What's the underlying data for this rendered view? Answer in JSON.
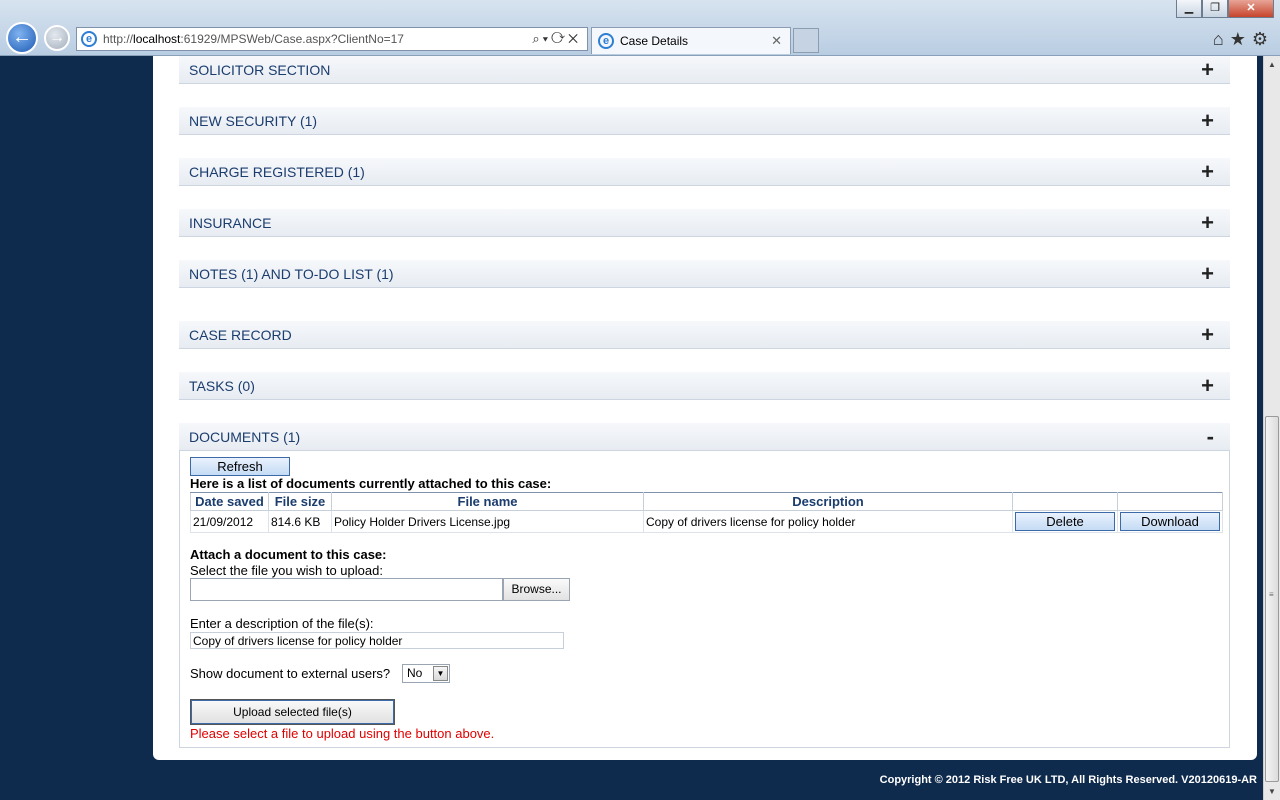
{
  "browser": {
    "url_prefix": "http://",
    "url_host": "localhost",
    "url_rest": ":61929/MPSWeb/Case.aspx?ClientNo=17",
    "tab_title": "Case Details",
    "window_buttons": [
      "▁",
      "❐",
      "✕"
    ]
  },
  "sections": [
    {
      "title": "SOLICITOR SECTION",
      "toggle": "+"
    },
    {
      "title": "NEW SECURITY (1)",
      "toggle": "+"
    },
    {
      "title": "CHARGE REGISTERED (1)",
      "toggle": "+"
    },
    {
      "title": "INSURANCE",
      "toggle": "+"
    },
    {
      "title": "NOTES (1) AND TO-DO LIST (1)",
      "toggle": "+"
    },
    {
      "title": "CASE RECORD",
      "toggle": "+"
    },
    {
      "title": "TASKS (0)",
      "toggle": "+"
    },
    {
      "title": "DOCUMENTS (1)",
      "toggle": "-"
    }
  ],
  "documents": {
    "refresh_label": "Refresh",
    "list_heading": "Here is a list of documents currently attached to this case:",
    "columns": [
      "Date saved",
      "File size",
      "File name",
      "Description",
      "",
      ""
    ],
    "rows": [
      {
        "date_saved": "21/09/2012",
        "file_size": "814.6 KB",
        "file_name": "Policy Holder Drivers License.jpg",
        "description": "Copy of drivers license for policy holder",
        "delete_label": "Delete",
        "download_label": "Download"
      }
    ],
    "attach_heading": "Attach a document to this case:",
    "select_label": "Select the file you wish to upload:",
    "browse_label": "Browse...",
    "file_value": "",
    "desc_label": "Enter a description of the file(s):",
    "desc_value": "Copy of drivers license for policy holder",
    "external_label": "Show document to external users?",
    "external_value": "No",
    "upload_label": "Upload selected file(s)",
    "upload_message": "Please select a file to upload using the button above."
  },
  "footer": "Copyright © 2012 Risk Free UK LTD, All Rights Reserved. V20120619-AR",
  "colors": {
    "page_background": "#0e2a4c",
    "section_title": "#1b3d6e",
    "error_text": "#e00000"
  }
}
